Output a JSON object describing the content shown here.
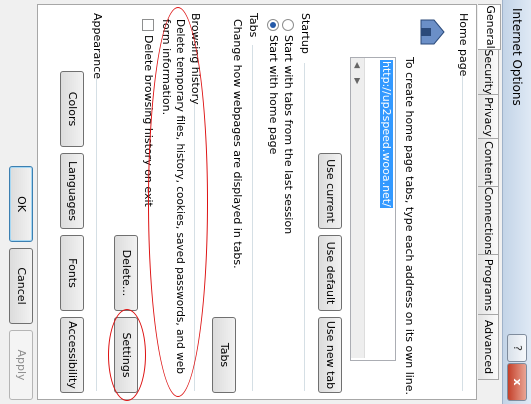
{
  "window": {
    "title": "Internet Options",
    "help": "?",
    "close": "x"
  },
  "tabs": [
    "General",
    "Security",
    "Privacy",
    "Content",
    "Connections",
    "Programs",
    "Advanced"
  ],
  "home_page": {
    "label": "Home page",
    "instruction": "To create home page tabs, type each address on its own line.",
    "url": "http://up2speed.wooa.net/",
    "use_current": "Use current",
    "use_default": "Use default",
    "use_new_tab": "Use new tab"
  },
  "startup": {
    "label": "Startup",
    "option1": "Start with tabs from the last session",
    "option2": "Start with home page"
  },
  "tabs_group": {
    "label": "Tabs",
    "text": "Change how webpages are displayed in tabs.",
    "button": "Tabs"
  },
  "browsing_history": {
    "label": "Browsing history",
    "text1": "Delete temporary files, history, cookies, saved passwords, and web",
    "text2": "form information.",
    "checkbox": "Delete browsing history on exit",
    "delete": "Delete...",
    "settings": "Settings"
  },
  "appearance": {
    "label": "Appearance",
    "colors": "Colors",
    "languages": "Languages",
    "fonts": "Fonts",
    "accessibility": "Accessibility"
  },
  "footer": {
    "ok": "OK",
    "cancel": "Cancel",
    "apply": "Apply"
  }
}
